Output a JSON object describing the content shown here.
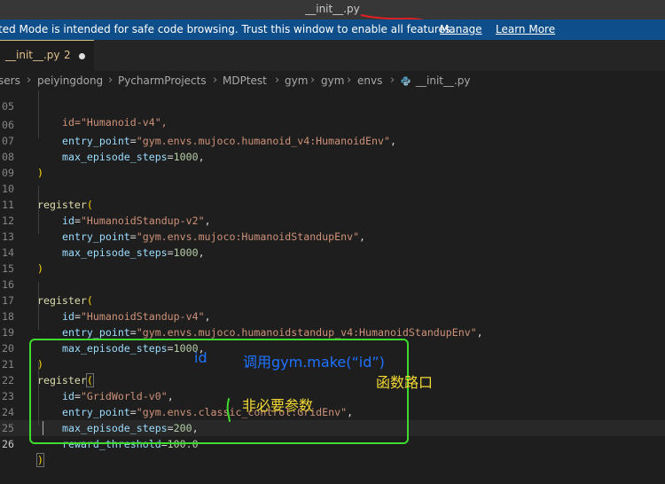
{
  "window": {
    "title": "__init__.py"
  },
  "banner": {
    "message": "ted Mode is intended for safe code browsing. Trust this window to enable all features.",
    "manage_label": "Manage",
    "learn_more_label": "Learn More"
  },
  "tab": {
    "filename": "__init__.py",
    "problem_count": "2"
  },
  "breadcrumb": {
    "items": [
      "sers",
      "peiyingdong",
      "PycharmProjects",
      "MDPtest",
      "gym",
      "gym",
      "envs",
      "__init__.py"
    ]
  },
  "editor": {
    "line_numbers": [
      "05",
      "06",
      "07",
      "08",
      "09",
      "10",
      "11",
      "12",
      "13",
      "14",
      "15",
      "16",
      "17",
      "18",
      "19",
      "20",
      "21",
      "22",
      "23",
      "24",
      "25",
      "26"
    ],
    "current_line": "26",
    "tokens": {
      "l05_id": "id=\"Humanoid-v4\",",
      "ep_kw": "entry_point",
      "eq": "=",
      "comma": ",",
      "mes_kw": "max_episode_steps",
      "id_kw": "id",
      "register": "register",
      "open_paren": "(",
      "close_paren": ")",
      "l06_val": "\"gym.envs.mujoco.humanoid_v4:HumanoidEnv\"",
      "l07_val": "1000",
      "l11_val": "\"HumanoidStandup-v2\"",
      "l12_val": "\"gym.envs.mujoco:HumanoidStandupEnv\"",
      "l13_val": "1000",
      "l17_val": "\"HumanoidStandup-v4\"",
      "l18_val": "\"gym.envs.mujoco.humanoidstandup_v4:HumanoidStandupEnv\"",
      "l19_val": "1000",
      "l22_val": "\"GridWorld-v0\"",
      "l23_val": "\"gym.envs.classic_control:GridEnv\"",
      "l24_val": "200",
      "rt_kw": "reward_threshold",
      "l25_val": "100.0"
    }
  },
  "annotations": {
    "id": "id",
    "make": "调用gym.make(“id”)",
    "func": "函数路口",
    "optional": "非必要参数"
  },
  "colors": {
    "banner_bg": "#0e4e8a",
    "box_green": "#3ddc2e",
    "annotation_blue": "#1e73ff",
    "annotation_yellow": "#f2d835",
    "title_underline_red": "#e02020"
  }
}
